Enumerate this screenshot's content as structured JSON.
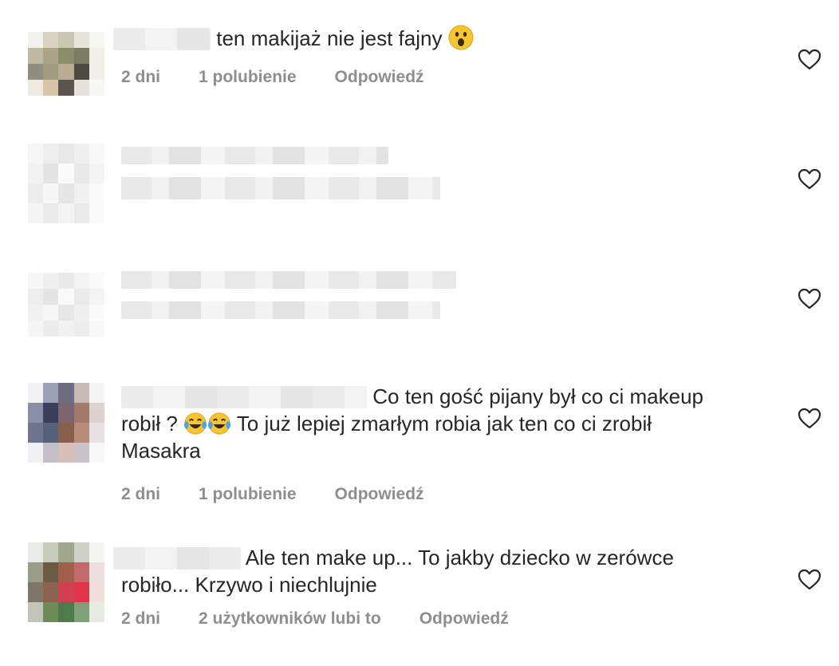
{
  "comments": [
    {
      "text": "ten makijaż nie jest fajny",
      "emoji": "astonished-face",
      "time": "2 dni",
      "likes": "1 polubienie",
      "reply": "Odpowiedź",
      "avatar_colors": [
        "#f4f2ee",
        "#d9d2c3",
        "#c9c8b2",
        "#e6e6dd",
        "#f6f6f2",
        "#bfb9a4",
        "#aba588",
        "#8a8f6a",
        "#7b7d64",
        "#f1efe8",
        "#8e8f80",
        "#a19b82",
        "#b9ae93",
        "#4d4a45",
        "#f0efe9",
        "#eeeae2",
        "#d8c4a8",
        "#5a5550",
        "#e5e2db",
        "#f7f7f5"
      ]
    },
    {
      "blurred": true,
      "avatar_colors": [
        "#f6f6f6",
        "#eeeeee",
        "#e8e8e8",
        "#f0f0f0",
        "#f8f8f8",
        "#f2f2f2",
        "#e4e4e4",
        "#fafafa",
        "#e9e9e9",
        "#f4f4f4",
        "#ededed",
        "#f7f7f7",
        "#e6e6e6",
        "#f1f1f1",
        "#fbfbfb",
        "#f5f5f5",
        "#eaeaea",
        "#f3f3f3",
        "#ebebeb",
        "#f9f9f9"
      ]
    },
    {
      "blurred": true,
      "avatar_colors": [
        "#f7f7f7",
        "#f0f0f0",
        "#e9e9e9",
        "#f3f3f3",
        "#fafafa",
        "#eeeeee",
        "#e5e5e5",
        "#f9f9f9",
        "#ebebeb",
        "#f4f4f4",
        "#f1f1f1",
        "#f6f6f6",
        "#e7e7e7",
        "#efefef",
        "#fbfbfb",
        "#f5f5f5",
        "#ececec",
        "#f2f2f2",
        "#ededed",
        "#f8f8f8"
      ]
    },
    {
      "text": "Co ten gość pijany był co ci makeup robił ? ",
      "text_after_emoji": " To już lepiej zmarłym robia jak ten co ci zrobił Masakra",
      "emoji": "tears-of-joy-face",
      "time": "2 dni",
      "likes": "1 polubienie",
      "reply": "Odpowiedź",
      "avatar_colors": [
        "#f2f2f4",
        "#9da0b5",
        "#6d6c80",
        "#c7b8b5",
        "#f5f5f6",
        "#8a8ea8",
        "#3b3f5c",
        "#7b6570",
        "#a4796a",
        "#ddd4d2",
        "#6f7390",
        "#566079",
        "#8a5e4c",
        "#b98b7b",
        "#e8e2e4",
        "#f1f1f3",
        "#c4bfc6",
        "#d7bfb8",
        "#c9c2cb",
        "#f8f8f8"
      ]
    },
    {
      "text": "Ale ten make up... To jakby dziecko w zerówce robiło... Krzywo i niechlujnie",
      "time": "2 dni",
      "likes": "2 użytkowników lubi to",
      "reply": "Odpowiedź",
      "avatar_colors": [
        "#e8ebe6",
        "#c7cdb9",
        "#9fa88c",
        "#cfd1c6",
        "#f5f5f3",
        "#9c9d86",
        "#6b5a44",
        "#a06049",
        "#c46a6a",
        "#ecdfe0",
        "#7e7668",
        "#8e6250",
        "#d0404e",
        "#e3344a",
        "#f1dede",
        "#c3c5bc",
        "#6d8c58",
        "#4f7a4c",
        "#7fa07a",
        "#e6ece4"
      ]
    }
  ]
}
